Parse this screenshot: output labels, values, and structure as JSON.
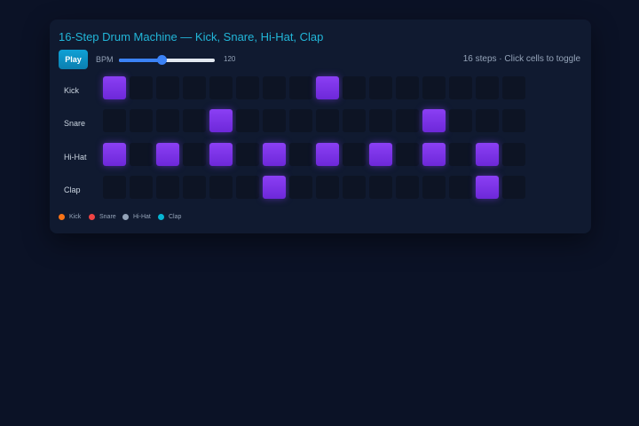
{
  "title": "16-Step Drum Machine — Kick, Snare, Hi-Hat, Clap",
  "controls": {
    "play_label": "Play",
    "bpm_label": "BPM",
    "bpm_value": "120",
    "bpm_fraction": 0.44
  },
  "info": "16 steps · Click cells to toggle",
  "tracks": [
    {
      "label": "Kick",
      "steps": [
        1,
        0,
        0,
        0,
        0,
        0,
        0,
        0,
        1,
        0,
        0,
        0,
        0,
        0,
        0,
        0
      ]
    },
    {
      "label": "Snare",
      "steps": [
        0,
        0,
        0,
        0,
        1,
        0,
        0,
        0,
        0,
        0,
        0,
        0,
        1,
        0,
        0,
        0
      ]
    },
    {
      "label": "Hi-Hat",
      "steps": [
        1,
        0,
        1,
        0,
        1,
        0,
        1,
        0,
        1,
        0,
        1,
        0,
        1,
        0,
        1,
        0
      ]
    },
    {
      "label": "Clap",
      "steps": [
        0,
        0,
        0,
        0,
        0,
        0,
        1,
        0,
        0,
        0,
        0,
        0,
        0,
        0,
        1,
        0
      ]
    }
  ],
  "legend": [
    {
      "label": "Kick",
      "color": "#f97316"
    },
    {
      "label": "Snare",
      "color": "#ef4444"
    },
    {
      "label": "Hi-Hat",
      "color": "#94a3b8"
    },
    {
      "label": "Clap",
      "color": "#06b6d4"
    }
  ],
  "colors": {
    "accent": "#22b6d8",
    "cell_on": "#7c3aed",
    "cell_off": "#0d1424",
    "background": "#0b1226",
    "panel": "#101a30"
  }
}
